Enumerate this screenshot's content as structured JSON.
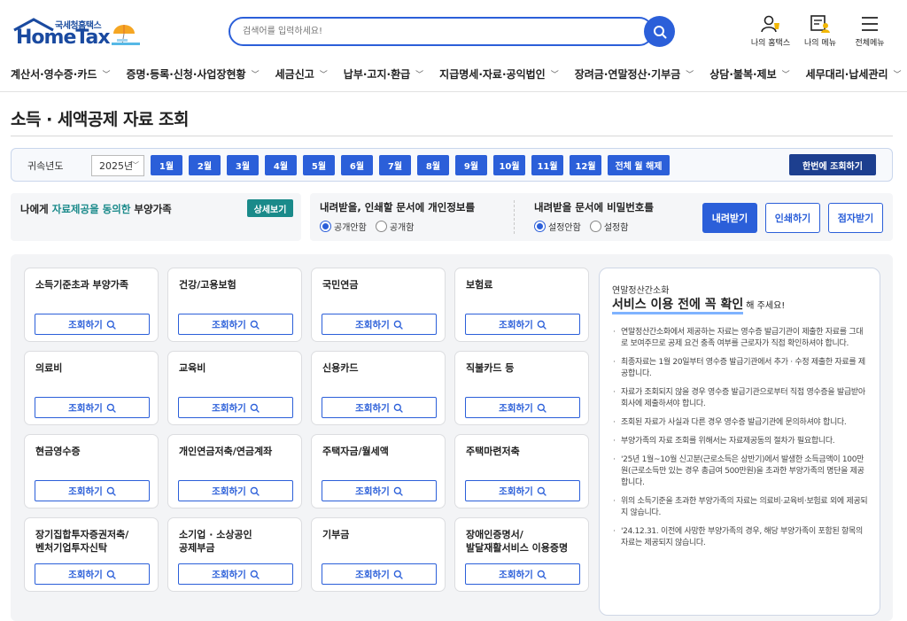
{
  "header": {
    "logo_sub": "국세청홈택스",
    "logo_main": "HomeTax",
    "search_placeholder": "검색어를 입력하세요!",
    "icons": [
      {
        "name": "my-hometax-icon",
        "label": "나의 홈택스"
      },
      {
        "name": "my-menu-icon",
        "label": "나의 메뉴"
      },
      {
        "name": "all-menu-icon",
        "label": "전체메뉴"
      }
    ]
  },
  "nav": {
    "items": [
      "계산서·영수증·카드",
      "증명·등록·신청·사업장현황",
      "세금신고",
      "납부·고지·환급",
      "지급명세·자료·공익법인",
      "장려금·연말정산·기부금",
      "상담·불복·제보",
      "세무대리·납세관리"
    ]
  },
  "page": {
    "title": "소득 · 세액공제 자료 조회"
  },
  "year_filter": {
    "label": "귀속년도",
    "selected_year": "2025년",
    "months": [
      "1월",
      "2월",
      "3월",
      "4월",
      "5월",
      "6월",
      "7월",
      "8월",
      "9월",
      "10월",
      "11월",
      "12월"
    ],
    "clear_all": "전체 월 해제",
    "search_all": "한번에 조회하기"
  },
  "options": {
    "consent_prefix": "나에게 ",
    "consent_accent": "자료제공을 동의한",
    "consent_suffix": " 부양가족",
    "detail_btn": "상세보기",
    "privacy_question": "내려받을, 인쇄할 문서에 개인정보를",
    "privacy_options": [
      "공개안함",
      "공개함"
    ],
    "password_question": "내려받을 문서에 비밀번호를",
    "password_options": [
      "설정안함",
      "설정함"
    ],
    "download_btn": "내려받기",
    "print_btn": "인쇄하기",
    "braille_btn": "점자받기"
  },
  "cards": {
    "button_label": "조회하기",
    "items": [
      {
        "title": "소득기준초과 부양가족"
      },
      {
        "title": "건강/고용보험"
      },
      {
        "title": "국민연금"
      },
      {
        "title": "보험료"
      },
      {
        "title": "의료비"
      },
      {
        "title": "교육비"
      },
      {
        "title": "신용카드"
      },
      {
        "title": "직불카드 등"
      },
      {
        "title": "현금영수증"
      },
      {
        "title": "개인연금저축/연금계좌"
      },
      {
        "title": "주택자금/월세액"
      },
      {
        "title": "주택마련저축"
      },
      {
        "title": "장기집합투자증권저축/\n벤처기업투자신탁"
      },
      {
        "title": "소기업 · 소상공인\n공제부금"
      },
      {
        "title": "기부금"
      },
      {
        "title": "장애인증명서/\n발달재활서비스 이용증명"
      }
    ]
  },
  "notice": {
    "sub": "연말정산간소화",
    "head": "서비스 이용 전에 꼭 확인",
    "head_suffix": "해 주세요!",
    "items": [
      "연말정산간소화에서 제공하는 자료는 영수증 발급기관이 제출한 자료를 그대로 보여주므로 공제 요건 충족 여부를 근로자가 직접 확인하셔야 합니다.",
      "최종자료는 1월 20일부터 영수증 발급기관에서 추가 · 수정 제출한 자료를 제공합니다.",
      "자료가 조회되지 않을 경우 영수증 발급기관으로부터 직접 영수증을 발급받아 회사에 제출하셔야 합니다.",
      "조회된 자료가 사실과 다른 경우 영수증 발급기관에 문의하셔야 합니다.",
      "부양가족의 자료 조회를 위해서는 자료제공동의 절차가 필요합니다.",
      "'25년 1월~10월 신고분(근로소득은 상반기)에서 발생한 소득금액이 100만원(근로소득만 있는 경우 총급여 500만원)을 초과한 부양가족의 명단을 제공합니다.",
      "위의 소득기준을 초과한 부양가족의 자료는 의료비·교육비·보험료 외에 제공되지 않습니다.",
      "'24.12.31. 이전에 사망한 부양가족의 경우, 해당 부양가족이 포함된 항목의 자료는 제공되지 않습니다."
    ]
  },
  "colors": {
    "primary": "#2b5fd9",
    "dark_primary": "#1d3f8f",
    "accent_teal": "#1a8a8a"
  }
}
